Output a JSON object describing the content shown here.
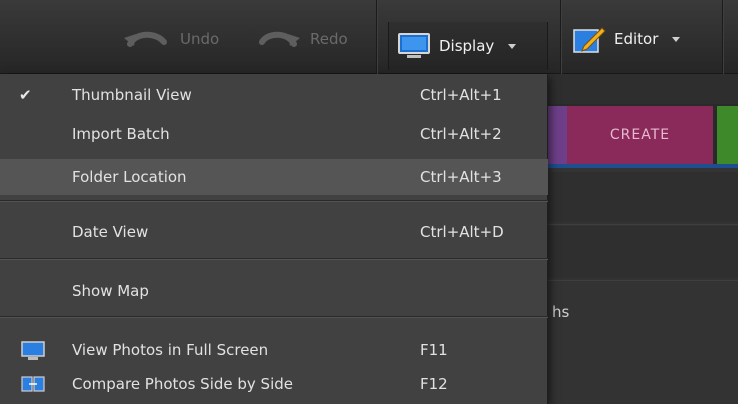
{
  "toolbar": {
    "undo_label": "Undo",
    "redo_label": "Redo",
    "display_label": "Display",
    "editor_label": "Editor"
  },
  "background": {
    "create_tab_label": "CREATE",
    "partial_text": "hs"
  },
  "menu": {
    "items": [
      {
        "label": "Thumbnail View",
        "shortcut": "Ctrl+Alt+1",
        "checked": true
      },
      {
        "label": "Import Batch",
        "shortcut": "Ctrl+Alt+2"
      },
      {
        "label": "Folder Location",
        "shortcut": "Ctrl+Alt+3",
        "highlighted": true
      },
      {
        "label": "Date View",
        "shortcut": "Ctrl+Alt+D"
      },
      {
        "label": "Show Map",
        "shortcut": ""
      },
      {
        "label": "View Photos in Full Screen",
        "shortcut": "F11",
        "icon": "monitor-icon"
      },
      {
        "label": "Compare Photos Side by Side",
        "shortcut": "F12",
        "icon": "compare-icon"
      }
    ]
  },
  "colors": {
    "accent_blue": "#1d4f8f",
    "create_tab": "#8a2a5a",
    "menu_bg": "#414141",
    "menu_highlight": "#555555"
  }
}
